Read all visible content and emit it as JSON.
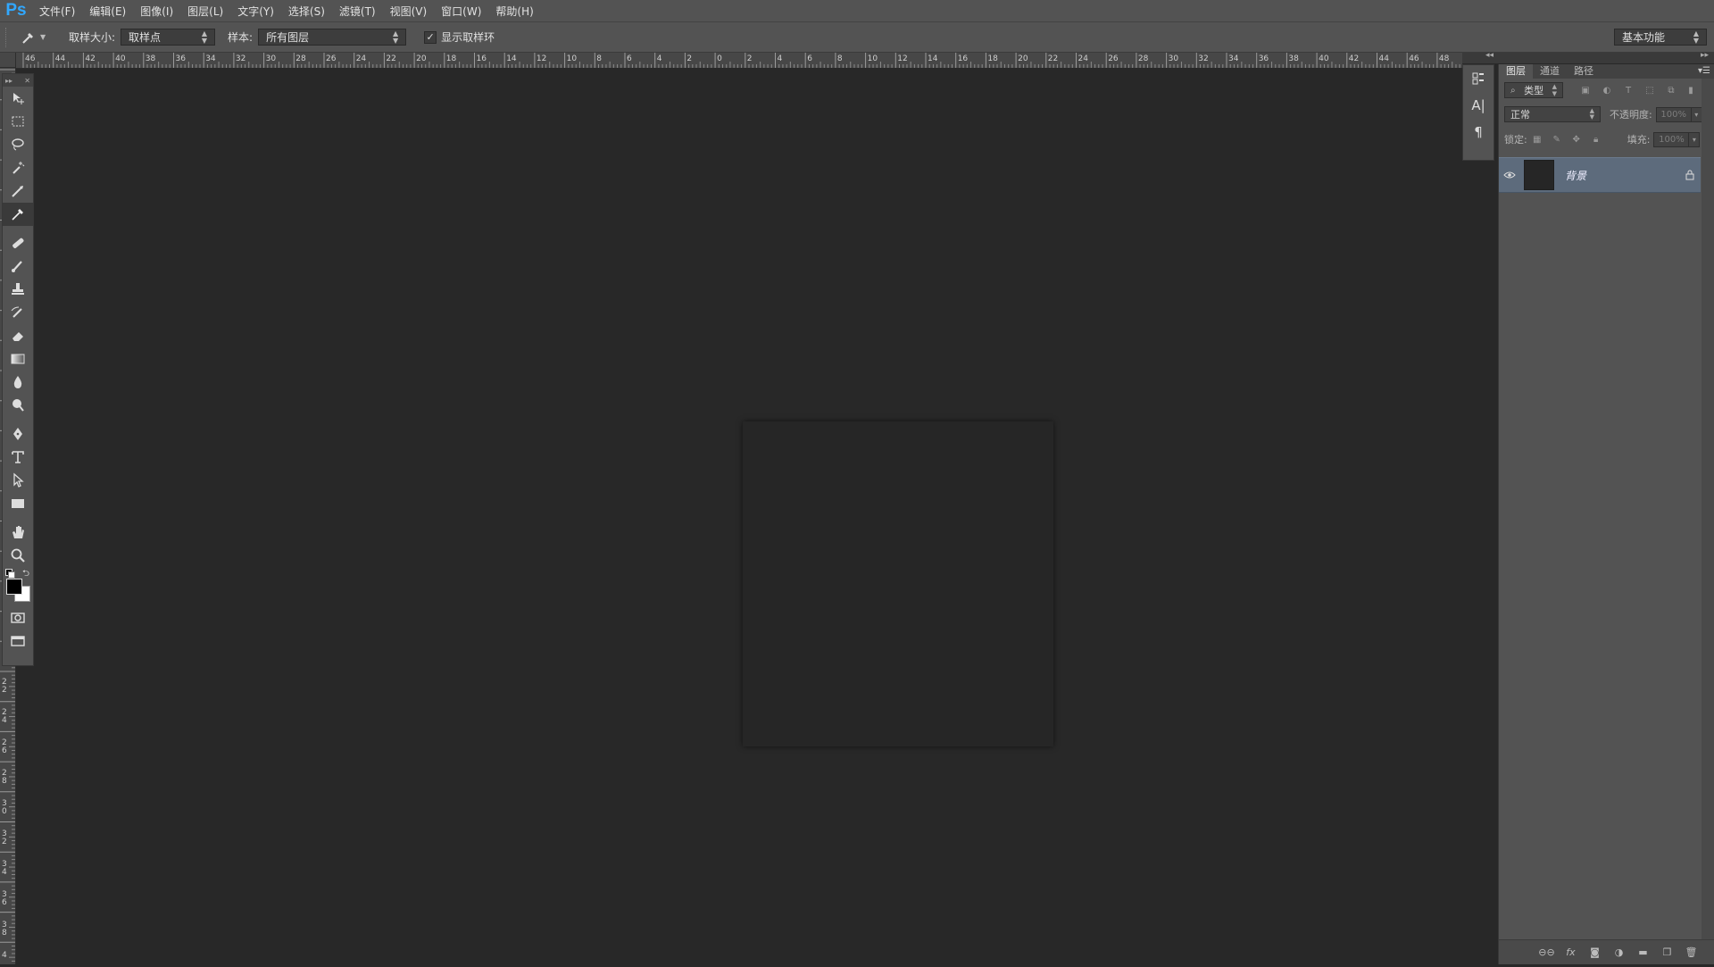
{
  "app": {
    "logo": "Ps"
  },
  "menu": [
    "文件(F)",
    "编辑(E)",
    "图像(I)",
    "图层(L)",
    "文字(Y)",
    "选择(S)",
    "滤镜(T)",
    "视图(V)",
    "窗口(W)",
    "帮助(H)"
  ],
  "options": {
    "sample_size_label": "取样大小:",
    "sample_size_value": "取样点",
    "sample_label": "样本:",
    "sample_value": "所有图层",
    "show_ring_label": "显示取样环",
    "show_ring_checked": true,
    "workspace": "基本功能"
  },
  "ruler": {
    "top_labels": [
      "46",
      "44",
      "42",
      "40",
      "38",
      "36",
      "34",
      "32",
      "30",
      "28",
      "26",
      "24",
      "22",
      "20",
      "18",
      "16",
      "14",
      "12",
      "10",
      "8",
      "6",
      "4",
      "2",
      "0",
      "2",
      "4",
      "6",
      "8",
      "10",
      "12",
      "14",
      "16",
      "18",
      "20",
      "22",
      "24",
      "26",
      "28",
      "30",
      "32",
      "34",
      "36",
      "38",
      "40",
      "42",
      "44",
      "46",
      "48"
    ],
    "left_labels": [
      "0",
      "2 2",
      "2 4",
      "2 6",
      "2 8",
      "3 0",
      "3 2",
      "3 4",
      "3 6",
      "3 8",
      "4"
    ]
  },
  "layers_panel": {
    "tabs": [
      "图层",
      "通道",
      "路径"
    ],
    "filter_kind": "类型",
    "blend_mode": "正常",
    "opacity_label": "不透明度:",
    "opacity_value": "100%",
    "lock_label": "锁定:",
    "fill_label": "填充:",
    "fill_value": "100%",
    "layer": {
      "name": "背景",
      "visible": true,
      "locked": true
    }
  },
  "colors": {
    "foreground": "#000000",
    "background": "#ffffff",
    "accent": "#31a8ff",
    "selected_layer": "#5d6b7c"
  }
}
